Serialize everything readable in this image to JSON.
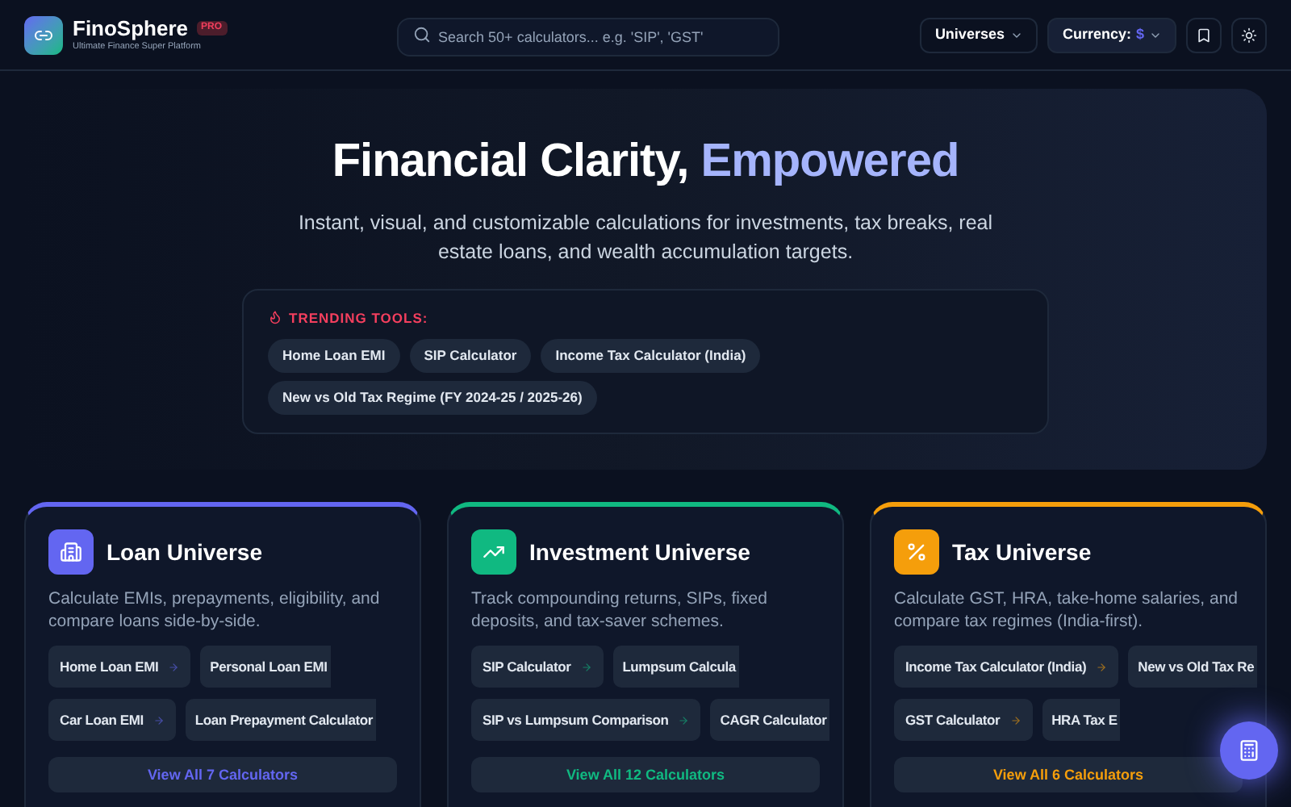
{
  "header": {
    "brand": "FinoSphere",
    "badge": "PRO",
    "tagline": "Ultimate Finance Super Platform",
    "search": {
      "placeholder": "Search 50+ calculators... e.g. 'SIP', 'GST'"
    },
    "universes_menu": "Universes",
    "currency": {
      "label": "Currency:",
      "symbol": "$"
    }
  },
  "hero": {
    "title": "Financial Clarity,",
    "title_accent": "Empowered",
    "subtitle": "Instant, visual, and customizable calculations for investments, tax breaks, real estate loans, and wealth accumulation targets.",
    "trending": {
      "label": "TRENDING TOOLS:",
      "tools": [
        "Home Loan EMI",
        "SIP Calculator",
        "Income Tax Calculator (India)",
        "New vs Old Tax Regime (FY 2024-25 / 2025-26)"
      ]
    }
  },
  "universes": [
    {
      "kind": "loan",
      "title": "Loan Universe",
      "color": "#6366f1",
      "description": "Calculate EMIs, prepayments, eligibility, and compare loans side-by-side.",
      "tools": [
        [
          "Home Loan EMI",
          "Personal Loan EMI"
        ],
        [
          "Car Loan EMI",
          "Loan Prepayment Calculator"
        ]
      ],
      "view_all": "View All 7 Calculators"
    },
    {
      "kind": "investment",
      "title": "Investment Universe",
      "color": "#10b981",
      "description": "Track compounding returns, SIPs, fixed deposits, and tax-saver schemes.",
      "tools": [
        [
          "SIP Calculator",
          "Lumpsum Calcula"
        ],
        [
          "SIP vs Lumpsum Comparison",
          "CAGR Calculator"
        ]
      ],
      "view_all": "View All 12 Calculators"
    },
    {
      "kind": "tax",
      "title": "Tax Universe",
      "color": "#f59e0b",
      "description": "Calculate GST, HRA, take-home salaries, and compare tax regimes (India-first).",
      "tools": [
        [
          "Income Tax Calculator (India)",
          "New vs Old Tax Re"
        ],
        [
          "GST Calculator",
          "HRA Tax E"
        ]
      ],
      "view_all": "View All 6 Calculators"
    }
  ]
}
